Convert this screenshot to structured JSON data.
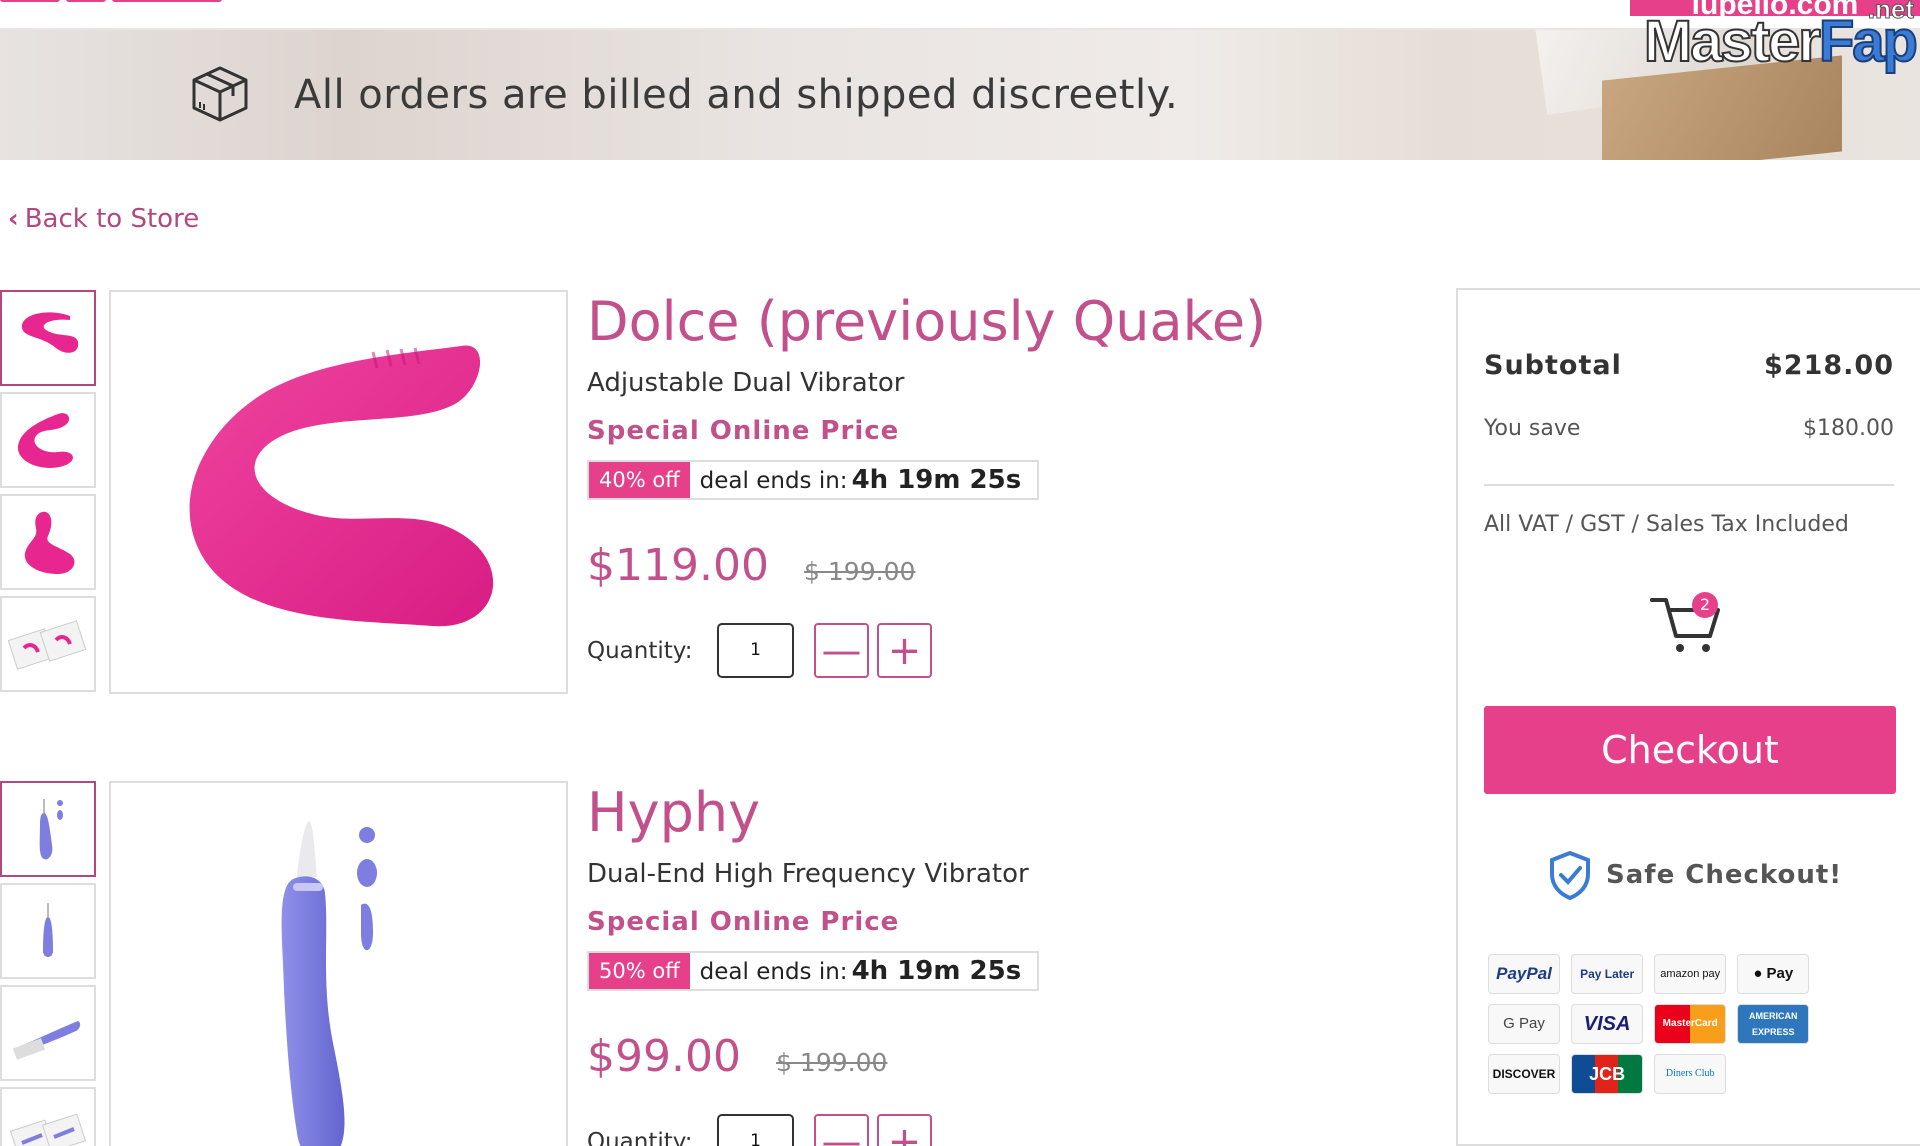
{
  "watermark": {
    "top_text": "lupello.com",
    "main_left": "Master",
    "main_right": "Fap",
    "suffix": ".net"
  },
  "banner": {
    "icon": "package-box-icon",
    "message": "All orders are billed and shipped discreetly."
  },
  "nav": {
    "back_label": "Back to Store",
    "back_icon": "chevron-left-icon"
  },
  "products": [
    {
      "name": "Dolce (previously Quake)",
      "subtitle": "Adjustable Dual Vibrator",
      "special_label": "Special Online Price",
      "discount": "40% off",
      "deal_label": "deal ends in:",
      "timer": "4h 19m 25s",
      "price": "$119.00",
      "old_price": "$ 199.00",
      "quantity_label": "Quantity:",
      "quantity": "1",
      "color": "#e8268f"
    },
    {
      "name": "Hyphy",
      "subtitle": "Dual-End High Frequency Vibrator",
      "special_label": "Special Online Price",
      "discount": "50% off",
      "deal_label": "deal ends in:",
      "timer": "4h 19m 25s",
      "price": "$99.00",
      "old_price": "$ 199.00",
      "quantity_label": "Quantity:",
      "quantity": "1",
      "color": "#7d7ee0"
    }
  ],
  "summary": {
    "subtotal_label": "Subtotal",
    "subtotal_value": "$218.00",
    "save_label": "You save",
    "save_value": "$180.00",
    "tax_note": "All VAT / GST / Sales Tax Included",
    "cart_count": "2",
    "checkout_label": "Checkout",
    "safe_label": "Safe Checkout!",
    "payment_methods": [
      "PayPal",
      "Pay Later",
      "amazon pay",
      "Pay",
      "G Pay",
      "VISA",
      "MasterCard",
      "AMERICAN EXPRESS",
      "DISCOVER",
      "JCB",
      "Diners Club"
    ]
  },
  "colors": {
    "accent": "#e7408b",
    "title": "#c2508b",
    "border": "#dddddd"
  }
}
